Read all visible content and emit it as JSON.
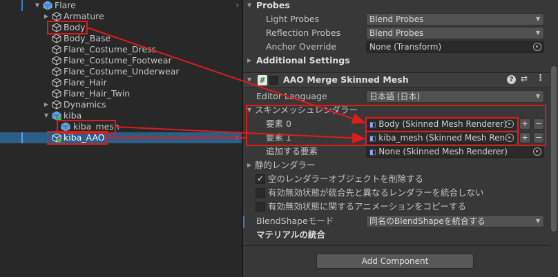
{
  "hierarchy": {
    "items": [
      {
        "label": "Flare",
        "fold": "down",
        "icon": "prefab-icon",
        "chevron": true
      },
      {
        "label": "Armature",
        "fold": "right",
        "icon": "gameobject-icon"
      },
      {
        "label": "Body",
        "icon": "gameobject-icon"
      },
      {
        "label": "Body_Base",
        "icon": "gameobject-icon"
      },
      {
        "label": "Flare_Costume_Dress",
        "icon": "gameobject-icon"
      },
      {
        "label": "Flare_Costume_Footwear",
        "icon": "gameobject-icon"
      },
      {
        "label": "Flare_Costume_Underwear",
        "icon": "gameobject-icon"
      },
      {
        "label": "Flare_Hair",
        "icon": "gameobject-icon"
      },
      {
        "label": "Flare_Hair_Twin",
        "icon": "gameobject-icon"
      },
      {
        "label": "Dynamics",
        "fold": "right",
        "icon": "gameobject-icon"
      },
      {
        "label": "kiba",
        "fold": "down",
        "icon": "prefab-icon"
      },
      {
        "label": "kiba_mesh",
        "icon": "prefab-icon"
      },
      {
        "label": "kiba_AAO",
        "icon": "gameobject-icon",
        "selected": true,
        "chevron": true
      }
    ]
  },
  "inspector": {
    "probes": {
      "title": "Probes",
      "light_probes_label": "Light Probes",
      "light_probes_value": "Blend Probes",
      "reflection_probes_label": "Reflection Probes",
      "reflection_probes_value": "Blend Probes",
      "anchor_override_label": "Anchor Override",
      "anchor_override_value": "None (Transform)"
    },
    "additional_settings": "Additional Settings",
    "component": {
      "title": "AAO Merge Skinned Mesh",
      "icon_glyph": "#",
      "enabled": true
    },
    "editor_language_label": "Editor Language",
    "editor_language_value": "日本語 (日本)",
    "renderers": {
      "title": "スキンメッシュレンダラー",
      "element0_label": "要素 0",
      "element0_value": "Body (Skinned Mesh Renderer)",
      "element1_label": "要素 1",
      "element1_value": "kiba_mesh (Skinned Mesh Rend",
      "add_label": "追加する要素",
      "add_value": "None (Skinned Mesh Renderer)",
      "plus": "+",
      "minus": "−"
    },
    "static_renderers": "静的レンダラー",
    "options": [
      {
        "label": "空のレンダラーオブジェクトを削除する",
        "checked": true
      },
      {
        "label": "有効無効状態が統合先と異なるレンダラーを統合しない",
        "checked": false
      },
      {
        "label": "有効無効状態に関するアニメーションをコピーする",
        "checked": false
      }
    ],
    "blendshape_label": "BlendShapeモード",
    "blendshape_value": "同名のBlendShapeを統合する",
    "material_merge": "マテリアルの統合",
    "add_component": "Add Component"
  },
  "colors": {
    "annotation_red": "#e01b1b",
    "selection_blue": "#2c5d87",
    "panel_dark": "#282828",
    "panel": "#383838"
  }
}
